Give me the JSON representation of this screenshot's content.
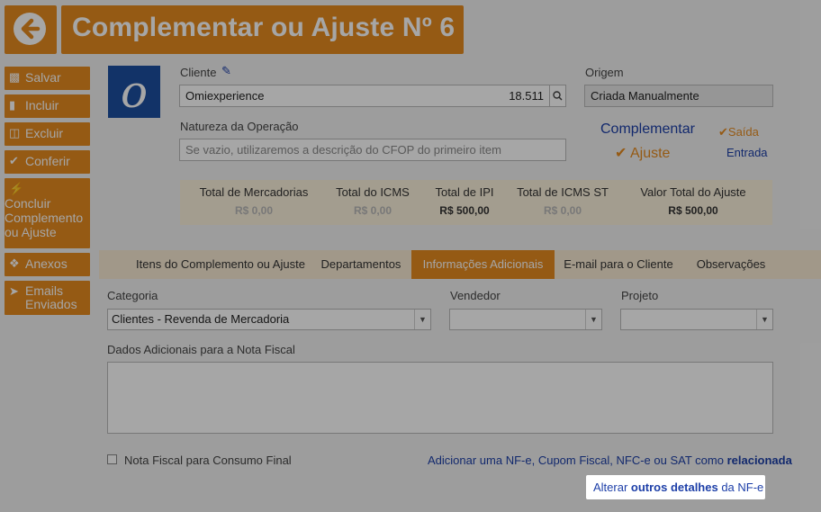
{
  "header": {
    "title": "Complementar ou Ajuste Nº 6",
    "back_icon": "arrow-left-icon"
  },
  "sidebar": {
    "items": [
      {
        "label": "Salvar",
        "icon": "save-icon"
      },
      {
        "label": "Incluir",
        "icon": "document-icon"
      },
      {
        "label": "Excluir",
        "icon": "trash-icon"
      },
      {
        "label": "Conferir",
        "icon": "check-icon"
      },
      {
        "label": "Concluir Complemento ou Ajuste",
        "icon": "bolt-icon"
      },
      {
        "label": "Anexos",
        "icon": "paperclip-icon"
      },
      {
        "label": "Emails Enviados",
        "icon": "send-icon"
      }
    ]
  },
  "logo": {
    "text": "o"
  },
  "form": {
    "cliente_label": "Cliente",
    "cliente_value": "Omiexperience",
    "cliente_code": "18.511",
    "origem_label": "Origem",
    "origem_value": "Criada Manualmente",
    "natureza_label": "Natureza da Operação",
    "natureza_placeholder": "Se vazio, utilizaremos a descrição do CFOP do primeiro item",
    "complementar": "Complementar",
    "ajuste": "Ajuste",
    "saida": "Saída",
    "entrada": "Entrada"
  },
  "totals": [
    {
      "label": "Total de Mercadorias",
      "value": "R$ 0,00"
    },
    {
      "label": "Total do ICMS",
      "value": "R$ 0,00"
    },
    {
      "label": "Total de IPI",
      "value": "R$ 500,00"
    },
    {
      "label": "Total de ICMS ST",
      "value": "R$ 0,00"
    },
    {
      "label": "Valor Total do Ajuste",
      "value": "R$ 500,00"
    }
  ],
  "tabs": [
    {
      "label": "Itens do Complemento ou Ajuste"
    },
    {
      "label": "Departamentos"
    },
    {
      "label": "Informações Adicionais"
    },
    {
      "label": "E-mail para o Cliente"
    },
    {
      "label": "Observações"
    }
  ],
  "info": {
    "categoria_label": "Categoria",
    "categoria_value": "Clientes - Revenda de Mercadoria",
    "vendedor_label": "Vendedor",
    "vendedor_value": "",
    "projeto_label": "Projeto",
    "projeto_value": "",
    "dados_label": "Dados Adicionais para a Nota Fiscal",
    "consumo_label": "Nota Fiscal para Consumo Final",
    "relacionada_prefix": "Adicionar uma NF-e, Cupom Fiscal, NFC-e ou SAT como ",
    "relacionada_bold": "relacionada",
    "outros_prefix": "Alterar ",
    "outros_bold": "outros detalhes",
    "outros_suffix": " da NF-e"
  },
  "colors": {
    "accent": "#e58a1f",
    "link": "#1d3fa8",
    "brand": "#1d4fa0"
  }
}
